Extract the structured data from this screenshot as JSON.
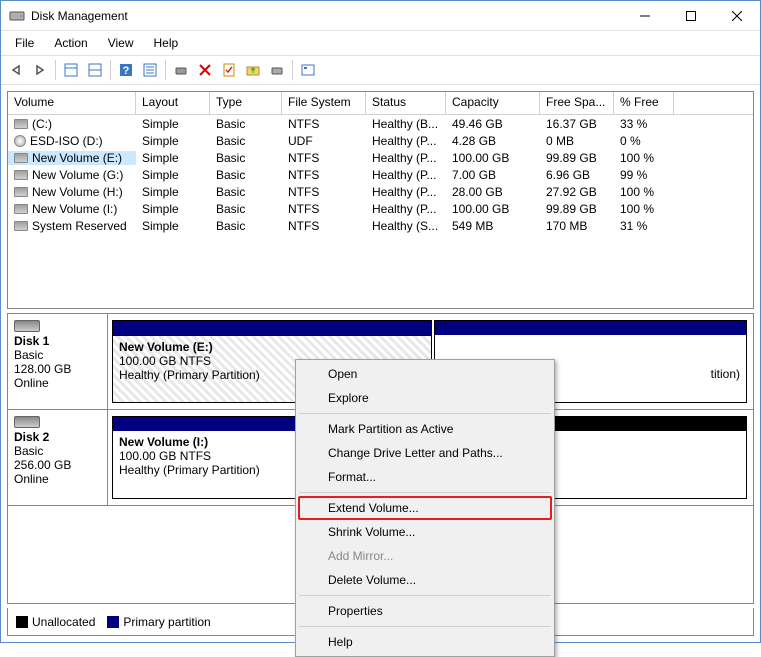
{
  "title": "Disk Management",
  "menu": {
    "file": "File",
    "action": "Action",
    "view": "View",
    "help": "Help"
  },
  "headers": {
    "volume": "Volume",
    "layout": "Layout",
    "type": "Type",
    "fs": "File System",
    "status": "Status",
    "capacity": "Capacity",
    "free": "Free Spa...",
    "pct": "% Free"
  },
  "volumes": [
    {
      "name": "(C:)",
      "layout": "Simple",
      "type": "Basic",
      "fs": "NTFS",
      "status": "Healthy (B...",
      "capacity": "49.46 GB",
      "free": "16.37 GB",
      "pct": "33 %",
      "cd": false
    },
    {
      "name": "ESD-ISO (D:)",
      "layout": "Simple",
      "type": "Basic",
      "fs": "UDF",
      "status": "Healthy (P...",
      "capacity": "4.28 GB",
      "free": "0 MB",
      "pct": "0 %",
      "cd": true
    },
    {
      "name": "New Volume (E:)",
      "layout": "Simple",
      "type": "Basic",
      "fs": "NTFS",
      "status": "Healthy (P...",
      "capacity": "100.00 GB",
      "free": "99.89 GB",
      "pct": "100 %",
      "cd": false,
      "selected": true
    },
    {
      "name": "New Volume (G:)",
      "layout": "Simple",
      "type": "Basic",
      "fs": "NTFS",
      "status": "Healthy (P...",
      "capacity": "7.00 GB",
      "free": "6.96 GB",
      "pct": "99 %",
      "cd": false
    },
    {
      "name": "New Volume (H:)",
      "layout": "Simple",
      "type": "Basic",
      "fs": "NTFS",
      "status": "Healthy (P...",
      "capacity": "28.00 GB",
      "free": "27.92 GB",
      "pct": "100 %",
      "cd": false
    },
    {
      "name": "New Volume (I:)",
      "layout": "Simple",
      "type": "Basic",
      "fs": "NTFS",
      "status": "Healthy (P...",
      "capacity": "100.00 GB",
      "free": "99.89 GB",
      "pct": "100 %",
      "cd": false
    },
    {
      "name": "System Reserved",
      "layout": "Simple",
      "type": "Basic",
      "fs": "NTFS",
      "status": "Healthy (S...",
      "capacity": "549 MB",
      "free": "170 MB",
      "pct": "31 %",
      "cd": false
    }
  ],
  "disks": {
    "d1": {
      "name": "Disk 1",
      "type": "Basic",
      "size": "128.00 GB",
      "state": "Online",
      "p1": {
        "title": "New Volume  (E:)",
        "line2": "100.00 GB NTFS",
        "line3": "Healthy (Primary Partition)"
      },
      "p2_suffix": "tition)"
    },
    "d2": {
      "name": "Disk 2",
      "type": "Basic",
      "size": "256.00 GB",
      "state": "Online",
      "p1": {
        "title": "New Volume  (I:)",
        "line2": "100.00 GB NTFS",
        "line3": "Healthy (Primary Partition)"
      }
    }
  },
  "legend": {
    "unalloc": "Unallocated",
    "primary": "Primary partition"
  },
  "ctx": {
    "open": "Open",
    "explore": "Explore",
    "mark": "Mark Partition as Active",
    "change": "Change Drive Letter and Paths...",
    "format": "Format...",
    "extend": "Extend Volume...",
    "shrink": "Shrink Volume...",
    "mirror": "Add Mirror...",
    "delete": "Delete Volume...",
    "props": "Properties",
    "help": "Help"
  }
}
